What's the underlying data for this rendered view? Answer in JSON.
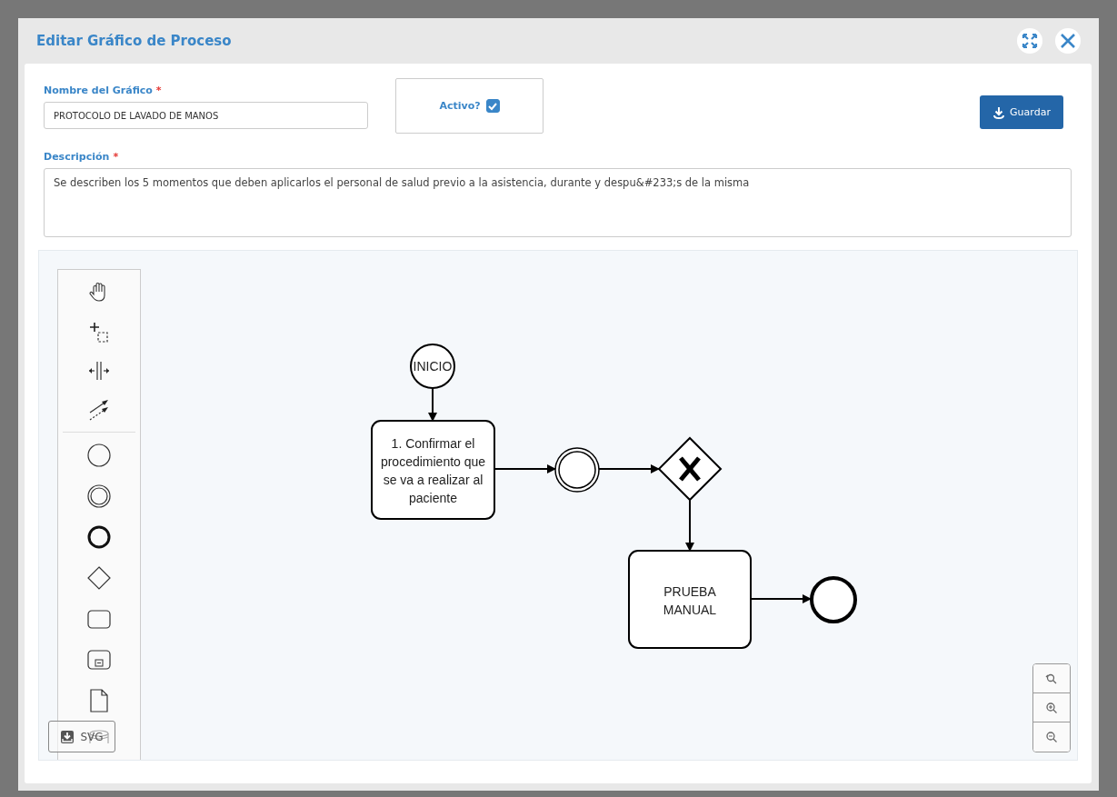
{
  "dialog": {
    "title": "Editar Gráfico de Proceso"
  },
  "form": {
    "name_label": "Nombre del Gráfico",
    "name_required_mark": "*",
    "name_value": "PROTOCOLO DE LAVADO DE MANOS",
    "active_label": "Activo?",
    "active_checked": true,
    "save_button": "Guardar",
    "description_label": "Descripción",
    "description_required_mark": "*",
    "description_value": "Se describen los 5 momentos que deben aplicarlos el personal de salud previo a la asistencia, durante y despu&#233;s de la misma"
  },
  "diagram": {
    "nodes": [
      {
        "kind": "start",
        "lines": [
          "INICIO"
        ]
      },
      {
        "kind": "task",
        "lines": [
          "1. Confirmar el",
          "procedimiento que",
          "se va a realizar al",
          "paciente"
        ]
      },
      {
        "kind": "intermediate"
      },
      {
        "kind": "gateway"
      },
      {
        "kind": "task",
        "lines": [
          "PRUEBA",
          "MANUAL"
        ]
      },
      {
        "kind": "end"
      }
    ]
  },
  "export_button": "SVG"
}
